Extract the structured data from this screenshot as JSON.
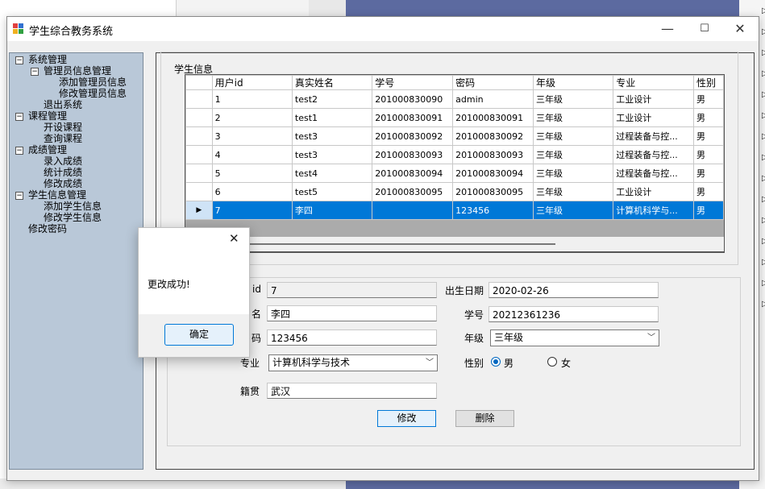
{
  "window": {
    "title": "学生综合教务系统",
    "min_glyph": "—",
    "max_glyph": "☐",
    "close_glyph": "✕"
  },
  "tree": [
    {
      "label": "系统管理",
      "level": 0,
      "box": "⊟"
    },
    {
      "label": "管理员信息管理",
      "level": 1,
      "box": "⊟"
    },
    {
      "label": "添加管理员信息",
      "level": 2
    },
    {
      "label": "修改管理员信息",
      "level": 2
    },
    {
      "label": "退出系统",
      "level": 1
    },
    {
      "label": "课程管理",
      "level": 0,
      "box": "⊟"
    },
    {
      "label": "开设课程",
      "level": 1
    },
    {
      "label": "查询课程",
      "level": 1
    },
    {
      "label": "成绩管理",
      "level": 0,
      "box": "⊟"
    },
    {
      "label": "录入成绩",
      "level": 1
    },
    {
      "label": "统计成绩",
      "level": 1
    },
    {
      "label": "修改成绩",
      "level": 1
    },
    {
      "label": "学生信息管理",
      "level": 0,
      "box": "⊟"
    },
    {
      "label": "添加学生信息",
      "level": 1
    },
    {
      "label": "修改学生信息",
      "level": 1
    },
    {
      "label": "修改密码",
      "level": 0
    }
  ],
  "student_group": {
    "label": "学生信息",
    "columns": [
      "用户id",
      "真实姓名",
      "学号",
      "密码",
      "年级",
      "专业",
      "性别"
    ],
    "rows": [
      [
        "1",
        "test2",
        "201000830090",
        "admin",
        "三年级",
        "工业设计",
        "男"
      ],
      [
        "2",
        "test1",
        "201000830091",
        "201000830091",
        "三年级",
        "工业设计",
        "男"
      ],
      [
        "3",
        "test3",
        "201000830092",
        "201000830092",
        "三年级",
        "过程装备与控...",
        "男"
      ],
      [
        "4",
        "test3",
        "201000830093",
        "201000830093",
        "三年级",
        "过程装备与控...",
        "男"
      ],
      [
        "5",
        "test4",
        "201000830094",
        "201000830094",
        "三年级",
        "过程装备与控...",
        "男"
      ],
      [
        "6",
        "test5",
        "201000830095",
        "201000830095",
        "三年级",
        "工业设计",
        "男"
      ],
      [
        "7",
        "李四",
        "",
        "123456",
        "三年级",
        "计算机科学与...",
        "男"
      ]
    ],
    "selected_row_marker": "▶"
  },
  "form": {
    "id_label": "id",
    "id_value": "7",
    "name_label": "名",
    "name_value": "李四",
    "pwd_label": "码",
    "pwd_value": "123456",
    "major_label": "专业",
    "major_value": "计算机科学与技术",
    "native_label": "籍贯",
    "native_value": "武汉",
    "birth_label": "出生日期",
    "birth_value": "2020-02-26",
    "sno_label": "学号",
    "sno_value": "20212361236",
    "grade_label": "年级",
    "grade_value": "三年级",
    "gender_label": "性别",
    "gender_male": "男",
    "gender_female": "女",
    "gender_selected": "男",
    "modify_button": "修改",
    "delete_button": "删除"
  },
  "messagebox": {
    "text": "更改成功!",
    "ok_button": "确定",
    "close_glyph": "✕"
  },
  "colors": {
    "selection": "#0078d7",
    "tree_bg": "#b9c8d8",
    "desktop_accent": "#5c6aa0"
  }
}
